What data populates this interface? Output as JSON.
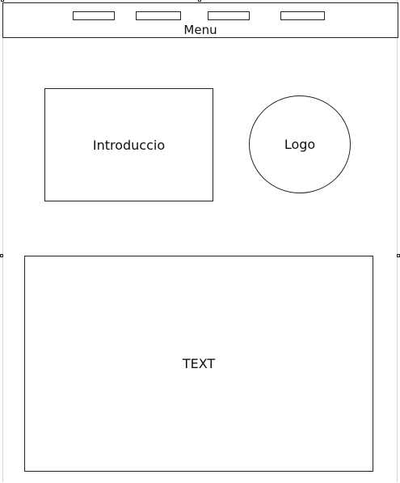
{
  "menu": {
    "label": "Menu",
    "items": [
      "",
      "",
      "",
      ""
    ]
  },
  "intro": {
    "label": "Introduccio"
  },
  "logo": {
    "label": "Logo"
  },
  "content": {
    "label": "TEXT"
  }
}
